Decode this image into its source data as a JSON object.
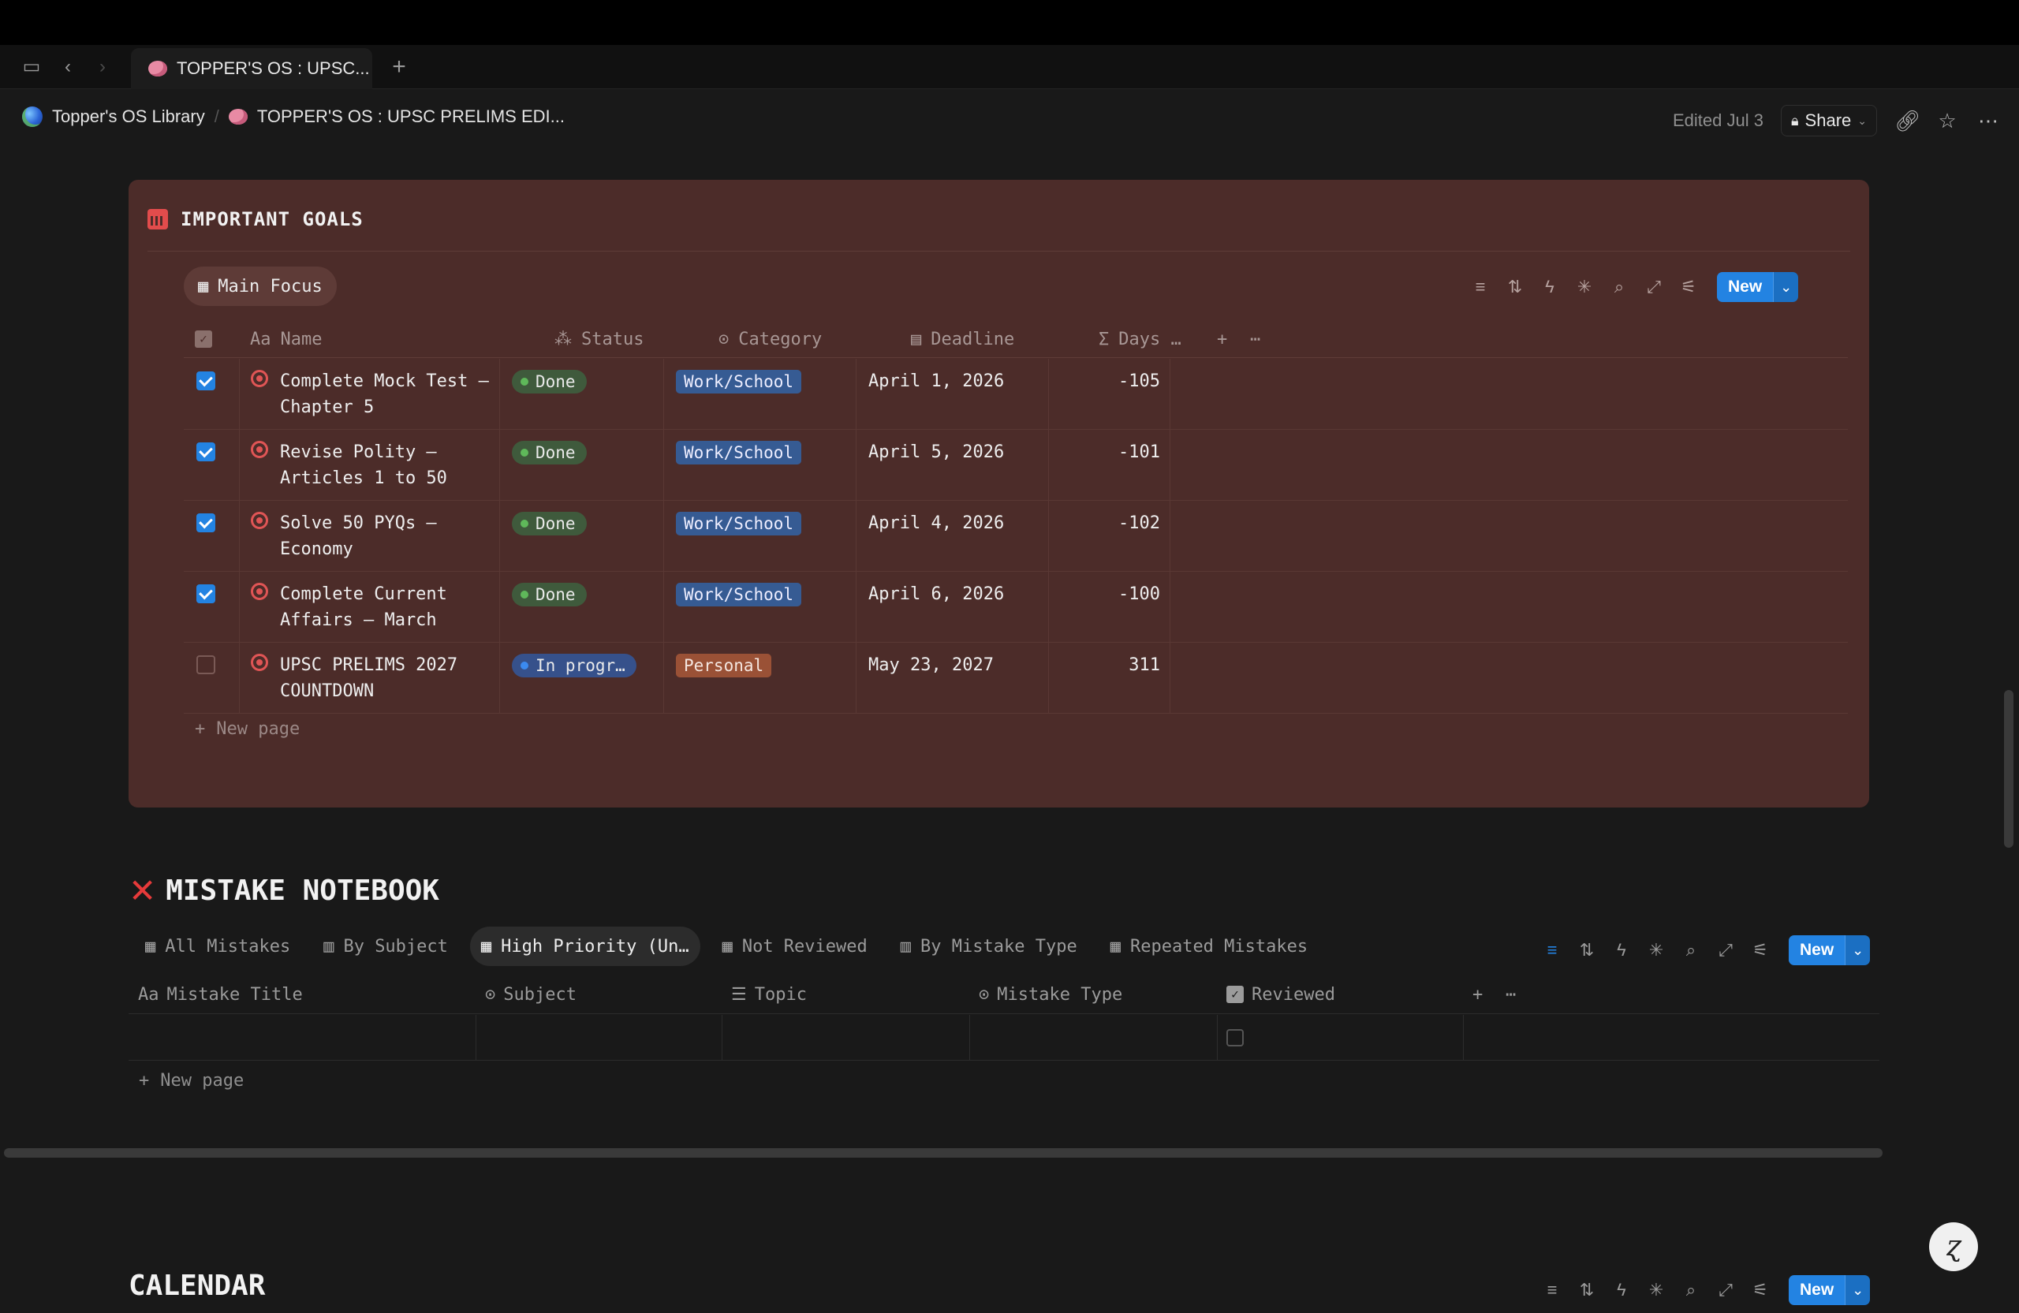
{
  "browser": {
    "tab_title": "TOPPER'S OS : UPSC...",
    "new_tab": "+"
  },
  "breadcrumb": {
    "root": "Topper's OS Library",
    "separator": "/",
    "page": "TOPPER'S OS : UPSC PRELIMS EDI..."
  },
  "topbar": {
    "edited": "Edited Jul 3",
    "share": "Share"
  },
  "goals": {
    "title": "IMPORTANT GOALS",
    "view": "Main Focus",
    "new_label": "New",
    "columns": {
      "name": "Name",
      "status": "Status",
      "category": "Category",
      "deadline": "Deadline",
      "days": "Days …"
    },
    "rows": [
      {
        "checked": true,
        "name": "Complete Mock Test — Chapter 5",
        "status": "Done",
        "category": "Work/School",
        "deadline": "April 1, 2026",
        "days": "-105"
      },
      {
        "checked": true,
        "name": "Revise Polity — Articles 1 to 50",
        "status": "Done",
        "category": "Work/School",
        "deadline": "April 5, 2026",
        "days": "-101"
      },
      {
        "checked": true,
        "name": "Solve 50 PYQs — Economy",
        "status": "Done",
        "category": "Work/School",
        "deadline": "April 4, 2026",
        "days": "-102"
      },
      {
        "checked": true,
        "name": "Complete Current Affairs — March",
        "status": "Done",
        "category": "Work/School",
        "deadline": "April 6, 2026",
        "days": "-100"
      },
      {
        "checked": false,
        "name": "UPSC PRELIMS 2027 COUNTDOWN",
        "status": "In progr…",
        "category": "Personal",
        "deadline": "May 23, 2027",
        "days": "311"
      }
    ],
    "new_page": "New page"
  },
  "mistakes": {
    "title": "MISTAKE NOTEBOOK",
    "tabs": [
      "All Mistakes",
      "By Subject",
      "High Priority (Un…",
      "Not Reviewed",
      "By Mistake Type",
      "Repeated Mistakes"
    ],
    "active_tab": 2,
    "new_label": "New",
    "columns": {
      "title": "Mistake Title",
      "subject": "Subject",
      "topic": "Topic",
      "type": "Mistake Type",
      "reviewed": "Reviewed"
    },
    "new_page": "New page"
  },
  "calendar": {
    "title": "CALENDAR",
    "new_label": "New"
  },
  "colors": {
    "accent": "#2383e2",
    "callout_bg": "#4c2c29",
    "done": "#3f5a3c",
    "in_progress": "#36518b",
    "work_school": "#365b93",
    "personal": "#9a5136"
  }
}
